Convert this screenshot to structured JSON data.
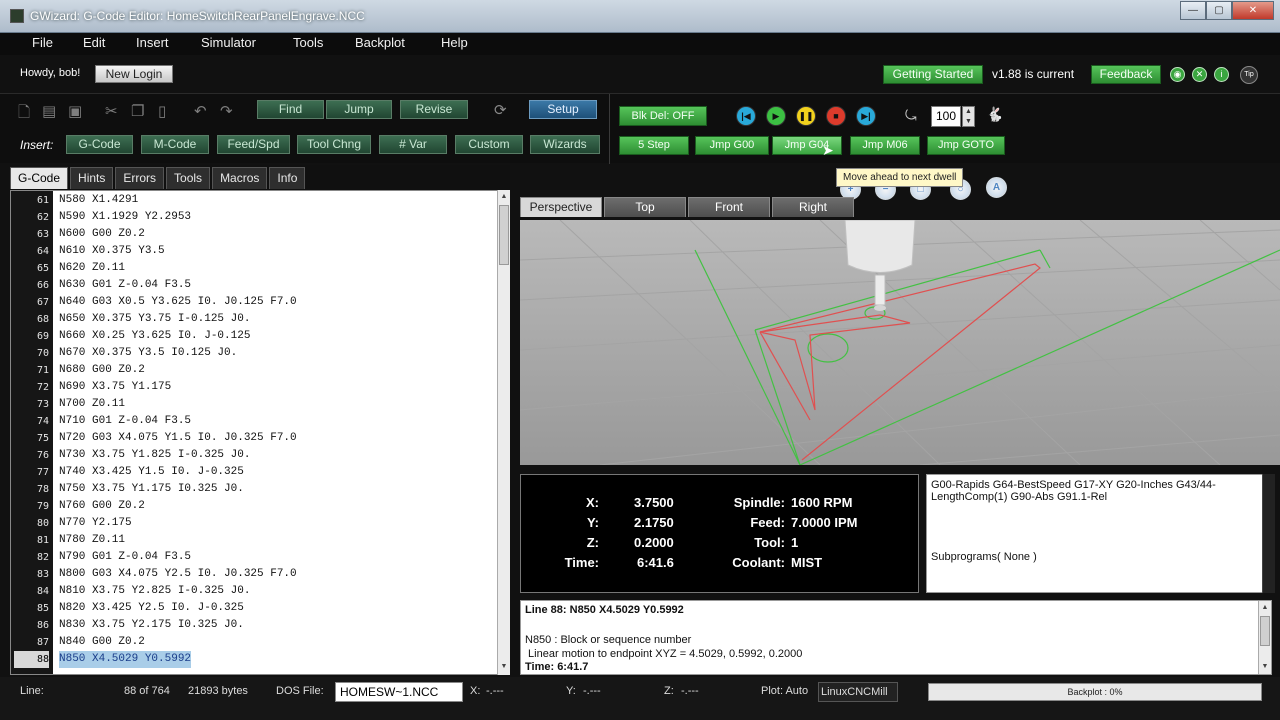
{
  "window": {
    "title": "GWizard: G-Code Editor: HomeSwitchRearPanelEngrave.NCC",
    "minimize": "—",
    "maximize": "▢",
    "close": "✕"
  },
  "menu": [
    "File",
    "Edit",
    "Insert",
    "Simulator",
    "Tools",
    "Backplot",
    "Help"
  ],
  "userbar": {
    "greeting": "Howdy, bob!",
    "new_login": "New Login",
    "getting_started": "Getting Started",
    "version": "v1.88 is current",
    "feedback": "Feedback",
    "tip": "Tip"
  },
  "toolbar": {
    "find": "Find",
    "jump": "Jump",
    "revise": "Revise",
    "setup": "Setup",
    "insert_label": "Insert:",
    "insert_buttons": [
      "G-Code",
      "M-Code",
      "Feed/Spd",
      "Tool Chng",
      "# Var",
      "Custom",
      "Wizards"
    ],
    "blkdel": "Blk Del: OFF",
    "step": "5 Step",
    "jumps": [
      "Jmp G00",
      "Jmp G04",
      "Jmp M06",
      "Jmp GOTO"
    ],
    "rate": "100"
  },
  "tooltip": "Move ahead to next dwell",
  "editor": {
    "tabs": [
      "G-Code",
      "Hints",
      "Errors",
      "Tools",
      "Macros",
      "Info"
    ],
    "lines": [
      {
        "n": "61",
        "code": "N580 X1.4291"
      },
      {
        "n": "62",
        "code": "N590 X1.1929 Y2.2953"
      },
      {
        "n": "63",
        "code": "N600 G00 Z0.2"
      },
      {
        "n": "64",
        "code": "N610 X0.375 Y3.5"
      },
      {
        "n": "65",
        "code": "N620 Z0.11"
      },
      {
        "n": "66",
        "code": "N630 G01 Z-0.04 F3.5"
      },
      {
        "n": "67",
        "code": "N640 G03 X0.5 Y3.625 I0. J0.125 F7.0"
      },
      {
        "n": "68",
        "code": "N650 X0.375 Y3.75 I-0.125 J0."
      },
      {
        "n": "69",
        "code": "N660 X0.25 Y3.625 I0. J-0.125"
      },
      {
        "n": "70",
        "code": "N670 X0.375 Y3.5 I0.125 J0."
      },
      {
        "n": "71",
        "code": "N680 G00 Z0.2"
      },
      {
        "n": "72",
        "code": "N690 X3.75 Y1.175"
      },
      {
        "n": "73",
        "code": "N700 Z0.11"
      },
      {
        "n": "74",
        "code": "N710 G01 Z-0.04 F3.5"
      },
      {
        "n": "75",
        "code": "N720 G03 X4.075 Y1.5 I0. J0.325 F7.0"
      },
      {
        "n": "76",
        "code": "N730 X3.75 Y1.825 I-0.325 J0."
      },
      {
        "n": "77",
        "code": "N740 X3.425 Y1.5 I0. J-0.325"
      },
      {
        "n": "78",
        "code": "N750 X3.75 Y1.175 I0.325 J0."
      },
      {
        "n": "79",
        "code": "N760 G00 Z0.2"
      },
      {
        "n": "80",
        "code": "N770 Y2.175"
      },
      {
        "n": "81",
        "code": "N780 Z0.11"
      },
      {
        "n": "82",
        "code": "N790 G01 Z-0.04 F3.5"
      },
      {
        "n": "83",
        "code": "N800 G03 X4.075 Y2.5 I0. J0.325 F7.0"
      },
      {
        "n": "84",
        "code": "N810 X3.75 Y2.825 I-0.325 J0."
      },
      {
        "n": "85",
        "code": "N820 X3.425 Y2.5 I0. J-0.325"
      },
      {
        "n": "86",
        "code": "N830 X3.75 Y2.175 I0.325 J0."
      },
      {
        "n": "87",
        "code": "N840 G00 Z0.2"
      },
      {
        "n": "88",
        "code": "N850 X4.5029 Y0.5992"
      }
    ],
    "selected_line": "88"
  },
  "viewer": {
    "tabs": [
      "Perspective",
      "Top",
      "Front",
      "Right"
    ]
  },
  "dro": {
    "x_label": "X:",
    "x": "3.7500",
    "y_label": "Y:",
    "y": "2.1750",
    "z_label": "Z:",
    "z": "0.2000",
    "time_label": "Time:",
    "time": "6:41.6",
    "spindle_label": "Spindle:",
    "spindle": "1600 RPM",
    "feed_label": "Feed:",
    "feed": "7.0000 IPM",
    "tool_label": "Tool:",
    "tool": "1",
    "coolant_label": "Coolant:",
    "coolant": "MIST"
  },
  "gstate": {
    "modes": "G00-Rapids G64-BestSpeed G17-XY G20-Inches G43/44-LengthComp(1) G90-Abs G91.1-Rel",
    "subprograms": "Subprograms( None )"
  },
  "explain": {
    "header": "Line 88: N850 X4.5029 Y0.5992",
    "desc1": "N850 : Block or sequence number",
    "desc2": " Linear motion to endpoint XYZ = 4.5029, 0.5992, 0.2000",
    "time": "Time: 6:41.7"
  },
  "status": {
    "line_label": "Line:",
    "line_info": "88 of 764",
    "bytes": "21893 bytes",
    "dos_label": "DOS File:",
    "dos_file": "HOMESW~1.NCC",
    "x_label": "X:",
    "x_val": "-.---",
    "y_label": "Y:",
    "y_val": "-.---",
    "z_label": "Z:",
    "z_val": "-.---",
    "plot": "Plot: Auto",
    "machine": "LinuxCNCMill",
    "backplot": "Backplot : 0%"
  },
  "colors": {
    "accent_green": "#3fae45",
    "dark_button": "#2b5a3f",
    "setup_blue": "#2a6592",
    "toolpath_red": "#e05050",
    "grid_green": "#43c143"
  }
}
